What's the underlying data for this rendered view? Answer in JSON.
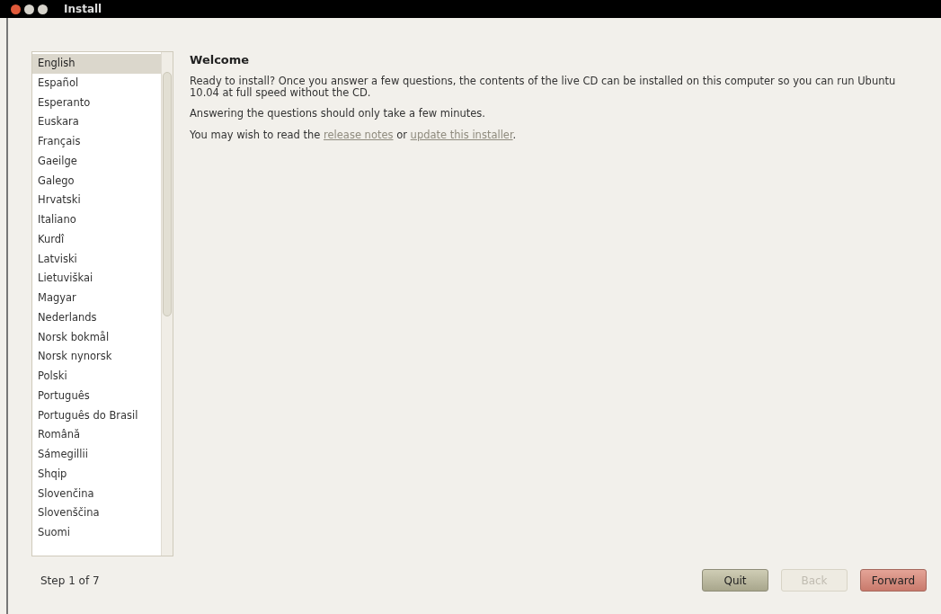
{
  "window": {
    "title": "Install"
  },
  "languages": [
    {
      "label": "English",
      "selected": true
    },
    {
      "label": "Español",
      "selected": false
    },
    {
      "label": "Esperanto",
      "selected": false
    },
    {
      "label": "Euskara",
      "selected": false
    },
    {
      "label": "Français",
      "selected": false
    },
    {
      "label": "Gaeilge",
      "selected": false
    },
    {
      "label": "Galego",
      "selected": false
    },
    {
      "label": "Hrvatski",
      "selected": false
    },
    {
      "label": "Italiano",
      "selected": false
    },
    {
      "label": "Kurdî",
      "selected": false
    },
    {
      "label": "Latviski",
      "selected": false
    },
    {
      "label": "Lietuviškai",
      "selected": false
    },
    {
      "label": "Magyar",
      "selected": false
    },
    {
      "label": "Nederlands",
      "selected": false
    },
    {
      "label": "Norsk bokmål",
      "selected": false
    },
    {
      "label": "Norsk nynorsk",
      "selected": false
    },
    {
      "label": "Polski",
      "selected": false
    },
    {
      "label": "Português",
      "selected": false
    },
    {
      "label": "Português do Brasil",
      "selected": false
    },
    {
      "label": "Română",
      "selected": false
    },
    {
      "label": "Sámegillii",
      "selected": false
    },
    {
      "label": "Shqip",
      "selected": false
    },
    {
      "label": "Slovenčina",
      "selected": false
    },
    {
      "label": "Slovenščina",
      "selected": false
    },
    {
      "label": "Suomi",
      "selected": false
    }
  ],
  "heading": "Welcome",
  "intro": "Ready to install?  Once you answer a few questions, the contents of the live CD can be installed on this computer so you can run Ubuntu 10.04 at full speed without the CD.",
  "note": "Answering the questions should only take a few minutes.",
  "links_sentence": {
    "before": "You may wish to read the",
    "link1": "release notes",
    "middle": "or",
    "link2": "update this installer",
    "after": "."
  },
  "step": "Step 1 of 7",
  "buttons": [
    {
      "label": "Quit",
      "kind": "quit",
      "disabled": false
    },
    {
      "label": "Back",
      "kind": "back",
      "disabled": true
    },
    {
      "label": "Forward",
      "kind": "forward",
      "disabled": false
    }
  ]
}
